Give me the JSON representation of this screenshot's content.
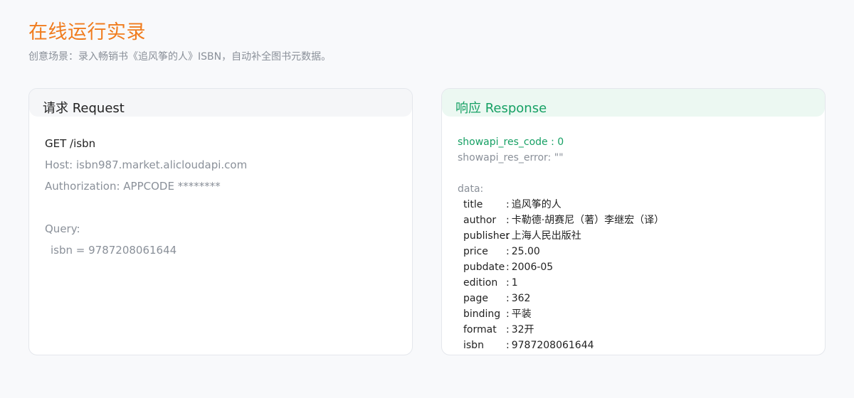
{
  "header": {
    "title": "在线运行实录",
    "subtitle": "创意场景：录入畅销书《追风筝的人》ISBN，自动补全图书元数据。"
  },
  "request": {
    "title": "请求 Request",
    "method_line": "GET /isbn",
    "host_line": "Host: isbn987.market.alicloudapi.com",
    "auth_line": "Authorization: APPCODE ********",
    "query_label": "Query:",
    "query_line": "isbn = 9787208061644"
  },
  "response": {
    "title": "响应 Response",
    "res_code_line": "showapi_res_code : 0",
    "res_error_line": "showapi_res_error: \"\"",
    "data_label": "data:",
    "fields": [
      {
        "key": "title",
        "value": "追风筝的人"
      },
      {
        "key": "author",
        "value": "卡勒德·胡赛尼（著）李继宏（译）"
      },
      {
        "key": "publisher",
        "value": "上海人民出版社"
      },
      {
        "key": "price",
        "value": "25.00"
      },
      {
        "key": "pubdate",
        "value": "2006-05"
      },
      {
        "key": "edition",
        "value": "1"
      },
      {
        "key": "page",
        "value": "362"
      },
      {
        "key": "binding",
        "value": "平装"
      },
      {
        "key": "format",
        "value": "32开"
      },
      {
        "key": "isbn",
        "value": "9787208061644"
      }
    ]
  },
  "colors": {
    "title_orange": "#f07c1e",
    "response_green": "#16a064",
    "muted_text": "#8a9099"
  }
}
